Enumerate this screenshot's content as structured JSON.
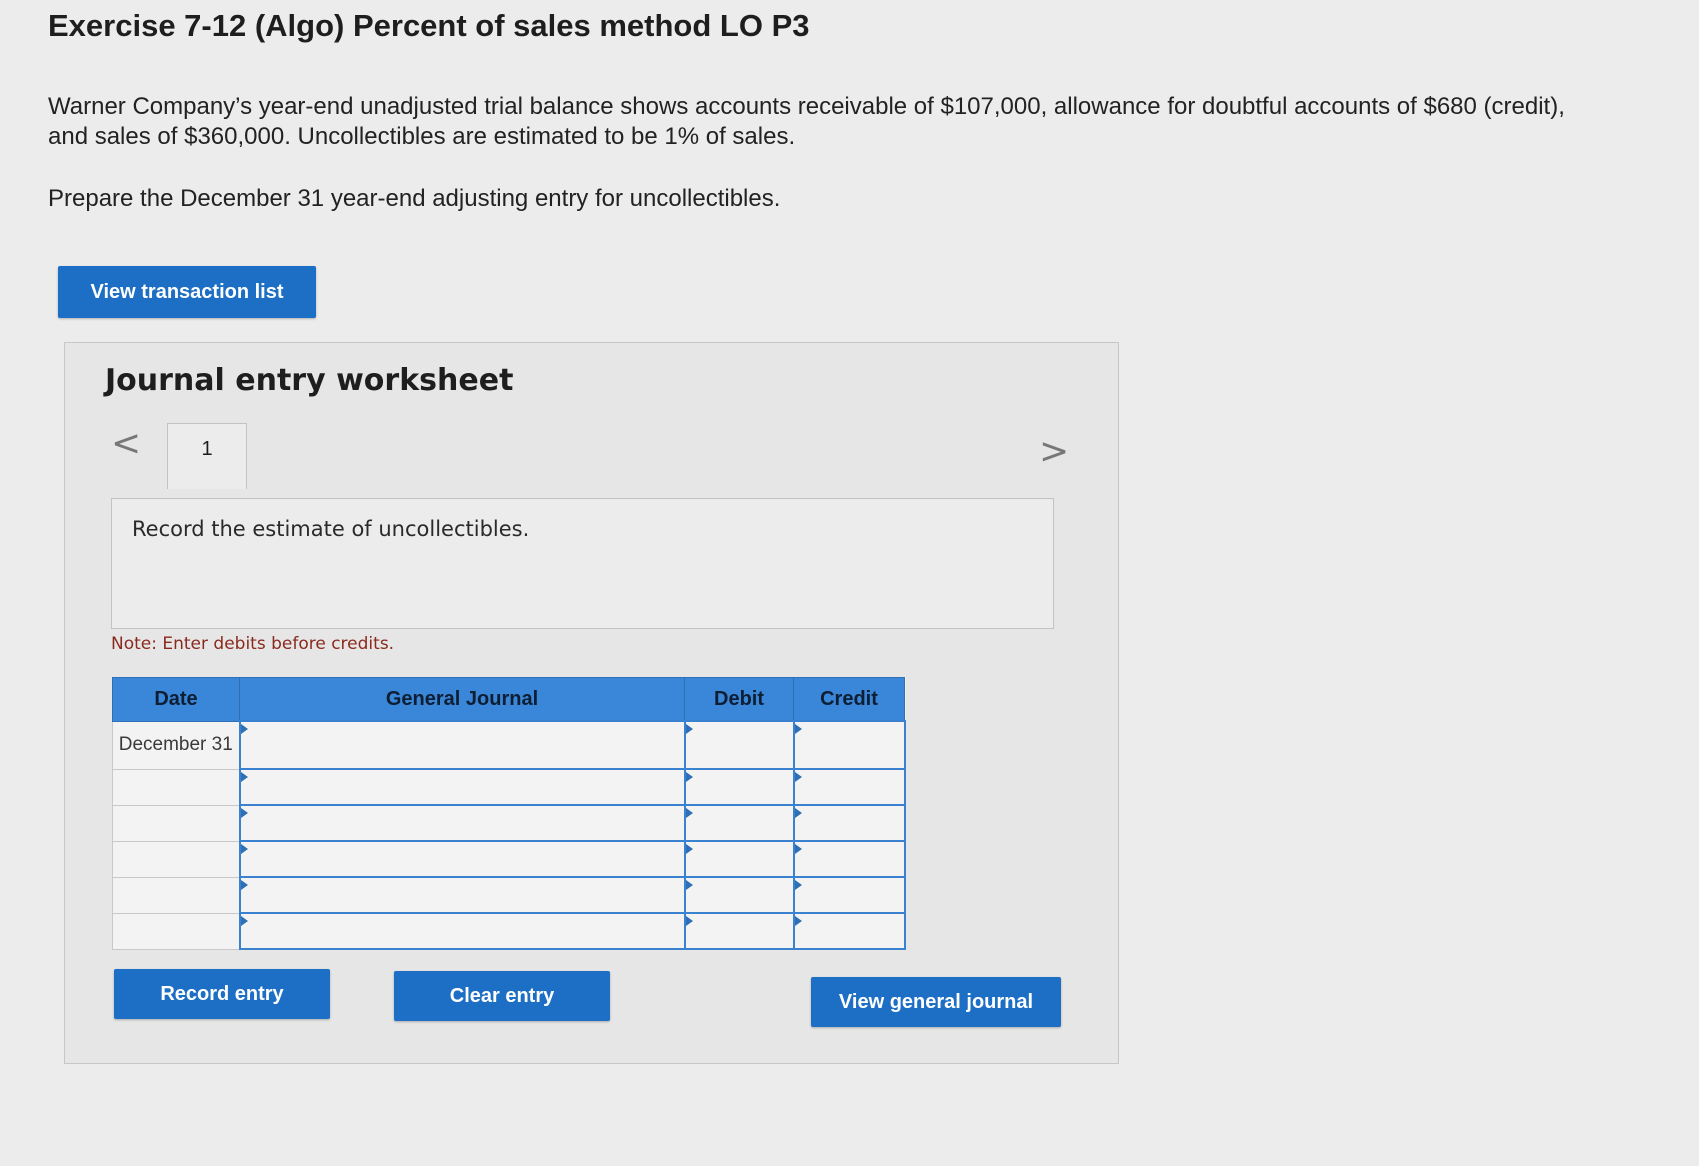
{
  "header": {
    "title": "Exercise 7-12 (Algo) Percent of sales method LO P3",
    "problem_text": "Warner Company’s year-end unadjusted trial balance shows accounts receivable of $107,000, allowance for doubtful accounts of $680 (credit), and sales of $360,000. Uncollectibles are estimated to be 1% of sales.",
    "instruction": "Prepare the December 31 year-end adjusting entry for uncollectibles."
  },
  "buttons": {
    "view_transaction_list": "View transaction list",
    "record_entry": "Record entry",
    "clear_entry": "Clear entry",
    "view_general_journal": "View general journal"
  },
  "worksheet": {
    "title": "Journal entry worksheet",
    "tab_number": "1",
    "nav_prev": "<",
    "nav_next": ">",
    "task_description": "Record the estimate of uncollectibles.",
    "note": "Note: Enter debits before credits.",
    "table": {
      "headers": [
        "Date",
        "General Journal",
        "Debit",
        "Credit"
      ],
      "rows": [
        {
          "date": "December 31",
          "account": "",
          "debit": "",
          "credit": ""
        },
        {
          "date": "",
          "account": "",
          "debit": "",
          "credit": ""
        },
        {
          "date": "",
          "account": "",
          "debit": "",
          "credit": ""
        },
        {
          "date": "",
          "account": "",
          "debit": "",
          "credit": ""
        },
        {
          "date": "",
          "account": "",
          "debit": "",
          "credit": ""
        },
        {
          "date": "",
          "account": "",
          "debit": "",
          "credit": ""
        }
      ]
    }
  },
  "colors": {
    "button_blue": "#1c6fc4",
    "header_blue": "#3a86d8",
    "note_red": "#8a2a1e"
  }
}
